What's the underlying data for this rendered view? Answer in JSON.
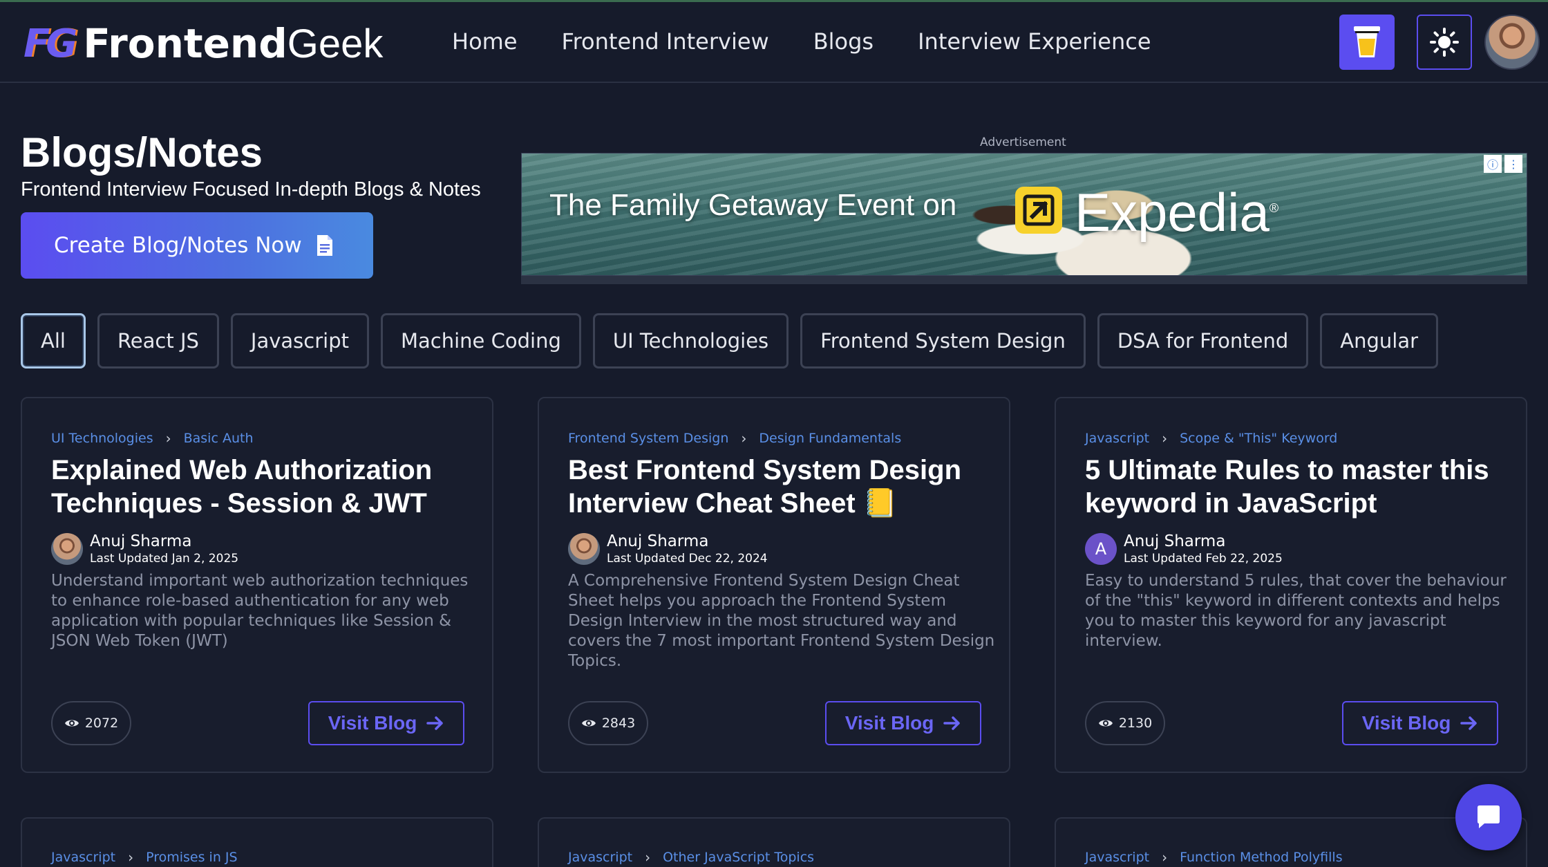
{
  "header": {
    "logo_mark": "FG",
    "logo_word1": "Frontend",
    "logo_word2": "Geek",
    "nav": [
      "Home",
      "Frontend Interview",
      "Blogs",
      "Interview Experience"
    ],
    "icons": {
      "coffee": "coffee-cup-icon",
      "theme": "sun-icon"
    }
  },
  "hero": {
    "title": "Blogs/Notes",
    "subtitle": "Frontend Interview Focused In-depth Blogs & Notes",
    "create_button": "Create Blog/Notes Now"
  },
  "ad": {
    "label": "Advertisement",
    "headline": "The Family Getaway Event on",
    "brand": "Expedia",
    "brand_suffix": "®"
  },
  "filters": [
    "All",
    "React JS",
    "Javascript",
    "Machine Coding",
    "UI Technologies",
    "Frontend System Design",
    "DSA for Frontend",
    "Angular"
  ],
  "active_filter": "All",
  "cards": [
    {
      "category": "UI Technologies",
      "subcategory": "Basic Auth",
      "title": "Explained Web Authorization Techniques - Session & JWT",
      "author": "Anuj Sharma",
      "updated": "Last Updated Jan 2, 2025",
      "description": "Understand important web authorization techniques to enhance role-based authentication for any web application with popular techniques like Session & JSON Web Token (JWT)",
      "views": "2072",
      "cta": "Visit Blog"
    },
    {
      "category": "Frontend System Design",
      "subcategory": "Design Fundamentals",
      "title": "Best Frontend System Design Interview Cheat Sheet 📒",
      "author": "Anuj Sharma",
      "updated": "Last Updated Dec 22, 2024",
      "description": "A Comprehensive Frontend System Design Cheat Sheet helps you approach the Frontend System Design Interview in the most structured way and covers the 7 most important Frontend System Design Topics.",
      "views": "2843",
      "cta": "Visit Blog"
    },
    {
      "category": "Javascript",
      "subcategory": "Scope & \"This\" Keyword",
      "title": "5 Ultimate Rules to master this keyword in JavaScript",
      "author": "Anuj Sharma",
      "author_initial": "A",
      "updated": "Last Updated Feb 22, 2025",
      "description": "Easy to understand 5 rules, that cover the behaviour of the \"this\" keyword in different contexts and helps you to master this keyword for any javascript interview.",
      "views": "2130",
      "cta": "Visit Blog"
    }
  ],
  "next_cards": [
    {
      "category": "Javascript",
      "subcategory": "Promises in JS"
    },
    {
      "category": "Javascript",
      "subcategory": "Other JavaScript Topics"
    },
    {
      "category": "Javascript",
      "subcategory": "Function Method Polyfills"
    }
  ],
  "colors": {
    "accent": "#5b4df0",
    "link": "#5a8fe6",
    "background": "#161b2b"
  }
}
